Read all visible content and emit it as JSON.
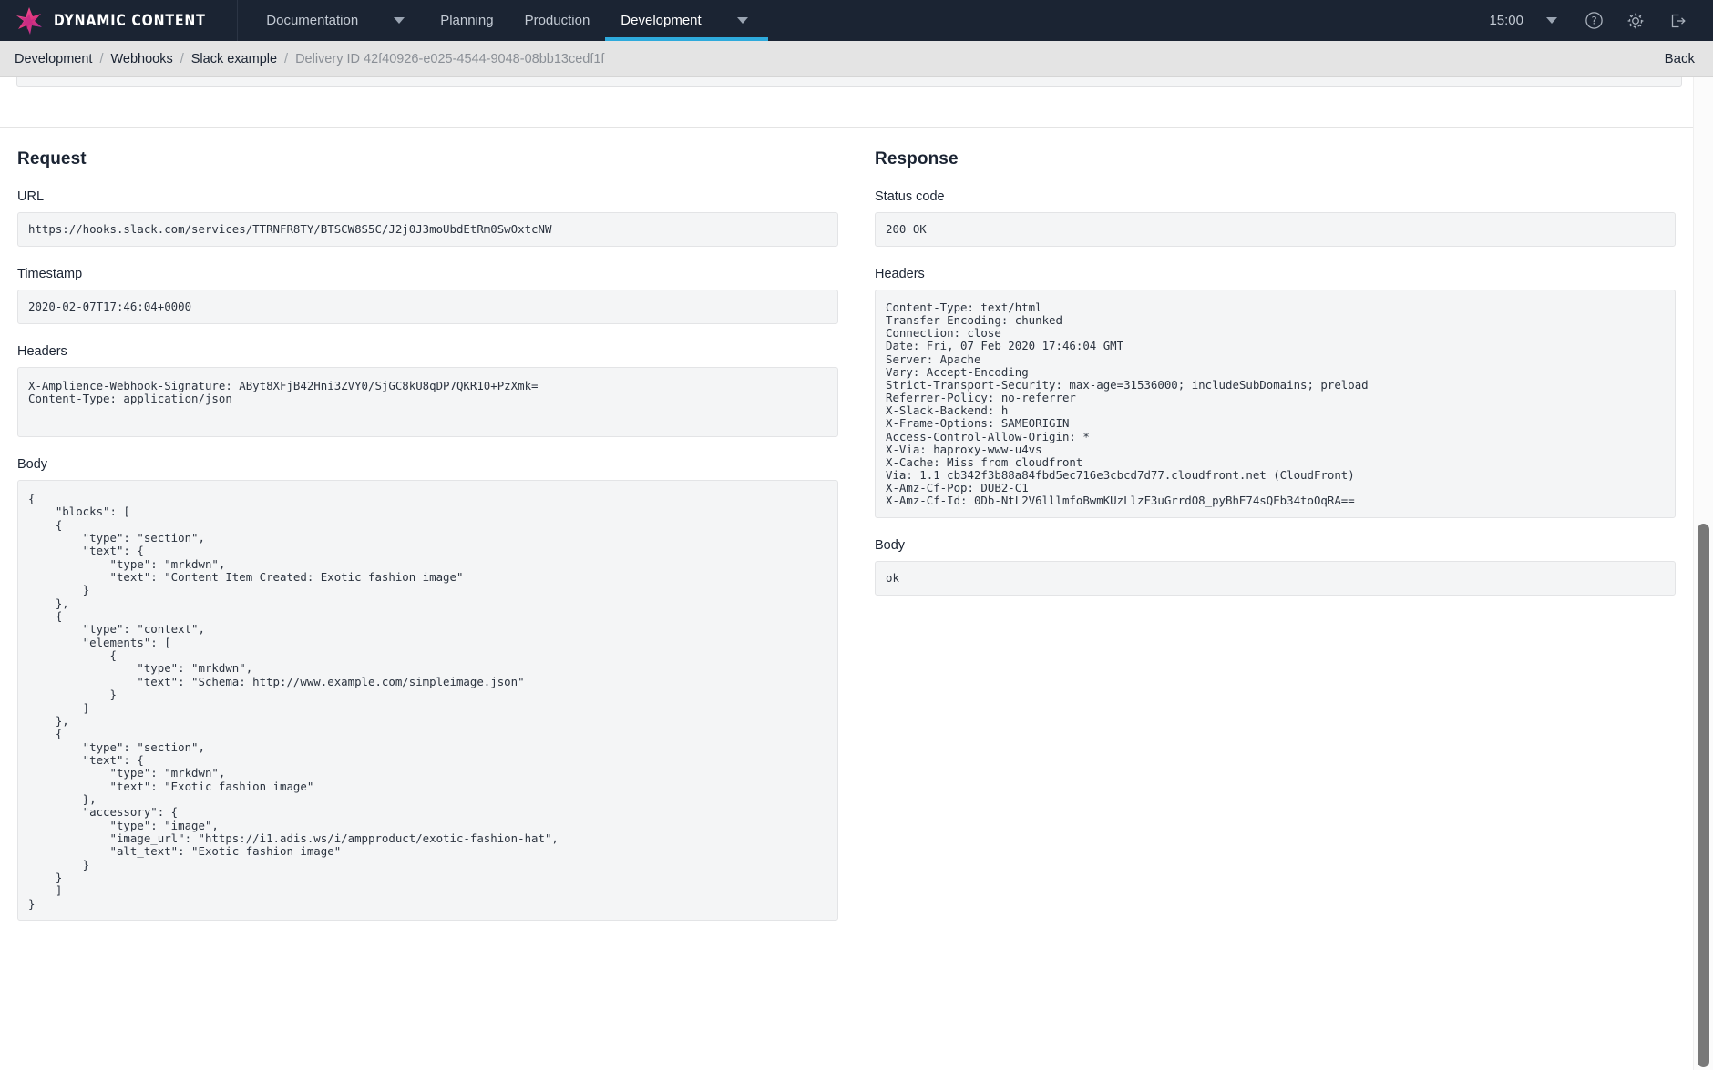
{
  "topbar": {
    "brand_name": "DYNAMIC CONTENT",
    "logo_icon": "amplience-star-logo",
    "nav": [
      {
        "label": "Documentation",
        "has_caret": true,
        "active": false
      },
      {
        "label": "Planning",
        "has_caret": false,
        "active": false
      },
      {
        "label": "Production",
        "has_caret": false,
        "active": false
      },
      {
        "label": "Development",
        "has_caret": true,
        "active": true
      }
    ],
    "clock": "15:00",
    "clock_caret_icon": "chevron-down-icon",
    "help_icon": "question-circle-icon",
    "settings_icon": "gear-icon",
    "signout_icon": "sign-out-icon"
  },
  "breadcrumb": {
    "items": [
      {
        "label": "Development",
        "muted": false
      },
      {
        "label": "Webhooks",
        "muted": false
      },
      {
        "label": "Slack example",
        "muted": false
      },
      {
        "label": "Delivery ID 42f40926-e025-4544-9048-08bb13cedf1f",
        "muted": true
      }
    ],
    "separator": "/",
    "back_label": "Back"
  },
  "request": {
    "title": "Request",
    "url_label": "URL",
    "url_value": "https://hooks.slack.com/services/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",
    "timestamp_label": "Timestamp",
    "timestamp_value": "2020-02-07T17:46:04+0000",
    "headers_label": "Headers",
    "headers_value": "X-Amplience-Webhook-Signature: AByt8XFjB42Hni3ZVY0/SjGC8kU8qDP7QKR10+PzXmk=\nContent-Type: application/json",
    "body_label": "Body",
    "body_value": "{\n    \"blocks\": [\n    {\n        \"type\": \"section\",\n        \"text\": {\n            \"type\": \"mrkdwn\",\n            \"text\": \"Content Item Created: Exotic fashion image\"\n        }\n    },\n    {\n        \"type\": \"context\",\n        \"elements\": [\n            {\n                \"type\": \"mrkdwn\",\n                \"text\": \"Schema: http://www.example.com/simpleimage.json\"\n            }\n        ]\n    },\n    {\n        \"type\": \"section\",\n        \"text\": {\n            \"type\": \"mrkdwn\",\n            \"text\": \"Exotic fashion image\"\n        },\n        \"accessory\": {\n            \"type\": \"image\",\n            \"image_url\": \"https://i1.adis.ws/i/ampproduct/exotic-fashion-hat\",\n            \"alt_text\": \"Exotic fashion image\"\n        }\n    }\n    ]\n}"
  },
  "response": {
    "title": "Response",
    "status_label": "Status code",
    "status_value": "200 OK",
    "headers_label": "Headers",
    "headers_value": "Content-Type: text/html\nTransfer-Encoding: chunked\nConnection: close\nDate: Fri, 07 Feb 2020 17:46:04 GMT\nServer: Apache\nVary: Accept-Encoding\nStrict-Transport-Security: max-age=31536000; includeSubDomains; preload\nReferrer-Policy: no-referrer\nX-Slack-Backend: h\nX-Frame-Options: SAMEORIGIN\nAccess-Control-Allow-Origin: *\nX-Via: haproxy-www-u4vs\nX-Cache: Miss from cloudfront\nVia: 1.1 cb342f3b88a84fbd5ec716e3cbcd7d77.cloudfront.net (CloudFront)\nX-Amz-Cf-Pop: DUB2-C1\nX-Amz-Cf-Id: 0Db-NtL2V6lllmfoBwmKUzLlzF3uGrrdO8_pyBhE74sQEb34toOqRA==",
    "body_label": "Body",
    "body_value": "ok"
  },
  "colors": {
    "topbar_bg": "#1b2433",
    "accent": "#2eaadc",
    "crumbbar_bg": "#e4e4e4",
    "readonly_bg": "#f4f5f6"
  }
}
